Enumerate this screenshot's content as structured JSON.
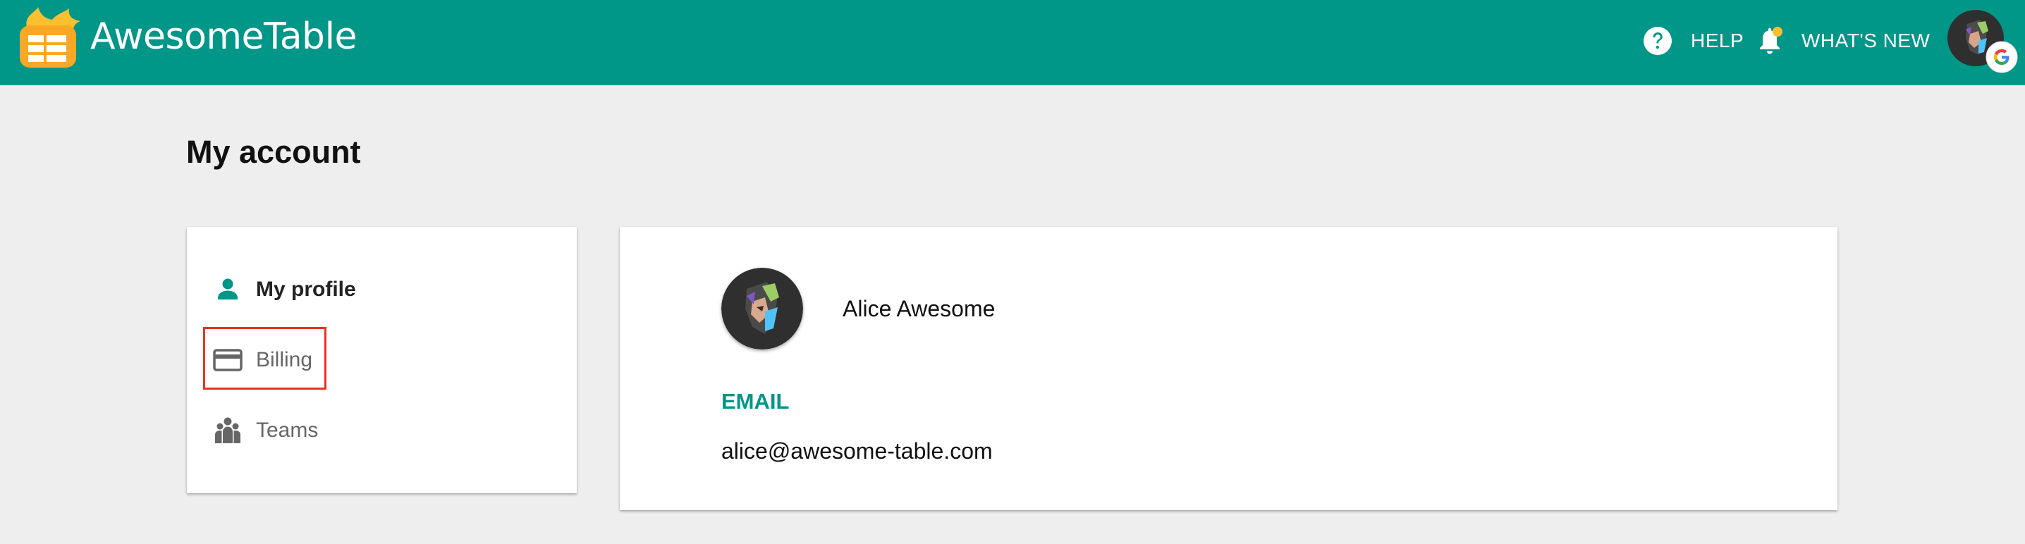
{
  "header": {
    "brand": "AwesomeTable",
    "help_label": "HELP",
    "whats_new_label": "WHAT'S NEW",
    "icons": {
      "logo": "awesome-table-logo",
      "help": "help-circle-icon",
      "notifications": "bell-icon",
      "account": "avatar",
      "provider": "google-icon"
    },
    "colors": {
      "bar": "#009688",
      "notification_dot": "#fbc02d"
    }
  },
  "page": {
    "title": "My account"
  },
  "sidebar": {
    "items": [
      {
        "label": "My profile",
        "icon": "person-icon",
        "active": true
      },
      {
        "label": "Billing",
        "icon": "credit-card-icon",
        "active": false,
        "highlighted": true
      },
      {
        "label": "Teams",
        "icon": "group-icon",
        "active": false
      }
    ]
  },
  "profile": {
    "name": "Alice Awesome",
    "email_label": "EMAIL",
    "email": "alice@awesome-table.com"
  },
  "colors": {
    "accent": "#009688",
    "highlight": "#e5341f"
  }
}
